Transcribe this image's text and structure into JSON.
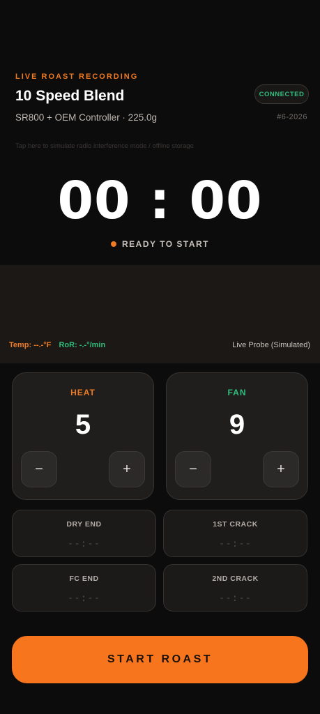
{
  "header": {
    "eyebrow": "LIVE ROAST RECORDING",
    "title": "10 Speed Blend",
    "subtitle": "SR800 + OEM Controller · 225.0g",
    "connection_status": "CONNECTED",
    "roast_id": "#6-2026"
  },
  "hint": "Tap here to simulate radio interference mode / offline storage",
  "timer": {
    "value": "00 : 00",
    "status": "READY TO START"
  },
  "chart_panel": {
    "temp_label": "Temp: --.-°F",
    "ror_label": "RoR: -.-°/min",
    "probe_label": "Live Probe (Simulated)"
  },
  "controls": {
    "heat": {
      "label": "HEAT",
      "value": "5",
      "decrement": "−",
      "increment": "+"
    },
    "fan": {
      "label": "FAN",
      "value": "9",
      "decrement": "−",
      "increment": "+"
    }
  },
  "milestones": [
    {
      "label": "DRY END",
      "value": "--:--"
    },
    {
      "label": "1ST CRACK",
      "value": "--:--"
    },
    {
      "label": "FC END",
      "value": "--:--"
    },
    {
      "label": "2ND CRACK",
      "value": "--:--"
    }
  ],
  "start_button": "START ROAST",
  "colors": {
    "accent": "#f07a22",
    "success": "#2fbe7e",
    "background": "#0d0c0c"
  }
}
